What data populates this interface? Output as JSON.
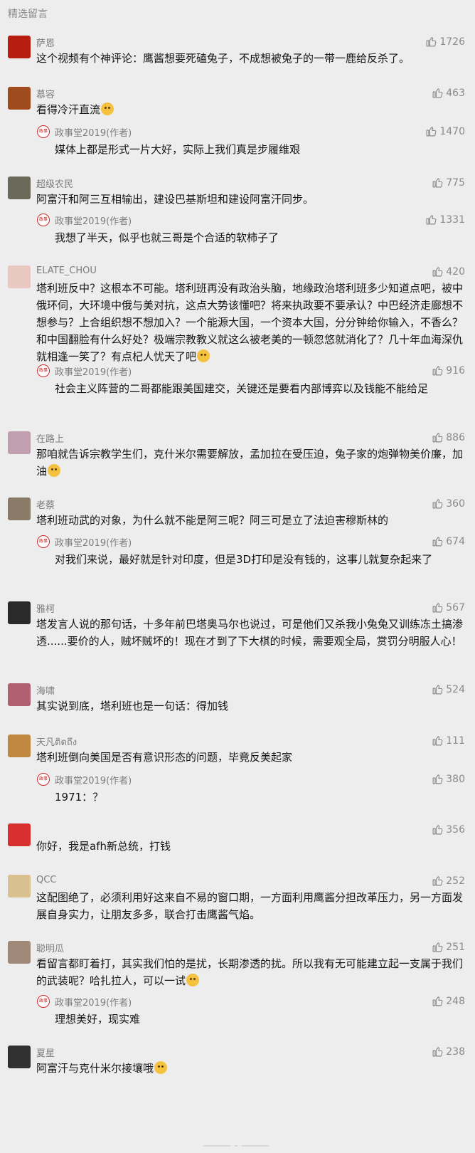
{
  "header": {
    "title": "精选留言"
  },
  "author_tag": "(作者)",
  "comments": [
    {
      "user": "萨恩",
      "likes": "1726",
      "text": "这个视频有个神评论：鹰酱想要死磕兔子，不成想被兔子的一带一鹿给反杀了。",
      "emoji": false,
      "avatar_color": "#b81d12"
    },
    {
      "user": "慕容",
      "likes": "463",
      "text": "看得冷汗直流",
      "emoji": true,
      "avatar_color": "#a04a20",
      "reply": {
        "name": "政事堂2019",
        "likes": "1470",
        "text": "媒体上都是形式一片大好，实际上我们真是步履维艰"
      }
    },
    {
      "user": "超级农民",
      "likes": "775",
      "text": "阿富汗和阿三互相输出，建设巴基斯坦和建设阿富汗同步。",
      "emoji": false,
      "avatar_color": "#6b6a5a",
      "reply": {
        "name": "政事堂2019",
        "likes": "1331",
        "text": "我想了半天，似乎也就三哥是个合适的软柿子了"
      }
    },
    {
      "user": "ELATE_CHOU",
      "likes": "420",
      "text": "塔利班反中？这根本不可能。塔利班再没有政治头脑，地缘政治塔利班多少知道点吧，被中俄环伺，大环境中俄与美对抗，这点大势该懂吧？将来执政要不要承认？中巴经济走廊想不想参与？上合组织想不想加入？一个能源大国，一个资本大国，分分钟给你输入，不香么？和中国翻脸有什么好处？极端宗教教义就这么被老美的一顿忽悠就消化了？几十年血海深仇就相逢一笑了？有点杞人忧天了吧",
      "emoji": true,
      "avatar_color": "#e8c8c0",
      "reply": {
        "name": "政事堂2019",
        "likes": "916",
        "text": "社会主义阵营的二哥都能跟美国建交，关键还是要看内部博弈以及钱能不能给足"
      }
    },
    {
      "user": "在路上",
      "likes": "886",
      "text": "那咱就告诉宗教学生们，克什米尔需要解放，孟加拉在受压迫，兔子家的炮弹物美价廉，加油",
      "emoji": true,
      "avatar_color": "#c0a0b0"
    },
    {
      "user": "老蔡",
      "likes": "360",
      "text": "塔利班动武的对象，为什么就不能是阿三呢？阿三可是立了法迫害穆斯林的",
      "emoji": false,
      "avatar_color": "#8a7a68",
      "reply": {
        "name": "政事堂2019",
        "likes": "674",
        "text": "对我们来说，最好就是针对印度，但是3D打印是没有钱的，这事儿就复杂起来了"
      }
    },
    {
      "user": "雅柯",
      "likes": "567",
      "text": "塔发言人说的那句话，十多年前巴塔奥马尔也说过，可是他们又杀我小兔兔又训练冻土搞渗透......要价的人，贼坏贼坏的！现在才到了下大棋的时候，需要观全局，赏罚分明服人心！",
      "emoji": false,
      "avatar_color": "#2a2a2a"
    },
    {
      "user": "海啸",
      "likes": "524",
      "text": "其实说到底，塔利班也是一句话：得加钱",
      "emoji": false,
      "avatar_color": "#b06070"
    },
    {
      "user": "天凡ติดถึง",
      "likes": "111",
      "text": "塔利班倒向美国是否有意识形态的问题，毕竟反美起家",
      "emoji": false,
      "avatar_color": "#c08840",
      "reply": {
        "name": "政事堂2019",
        "likes": "380",
        "text": "1971：？"
      }
    },
    {
      "user": "",
      "likes": "356",
      "text": "你好，我是afh新总统，打钱",
      "emoji": false,
      "avatar_color": "#d83030"
    },
    {
      "user": "QCC",
      "likes": "252",
      "text": "这配图绝了，必须利用好这来自不易的窗口期，一方面利用鹰酱分担改革压力，另一方面发展自身实力，让朋友多多，联合打击鹰酱气焰。",
      "emoji": false,
      "avatar_color": "#d8c090"
    },
    {
      "user": "聪明瓜",
      "likes": "251",
      "text": "看留言都盯着打，其实我们怕的是扰，长期渗透的扰。所以我有无可能建立起一支属于我们的武装呢？哈扎拉人，可以一试",
      "emoji": true,
      "avatar_color": "#a08878",
      "reply": {
        "name": "政事堂2019",
        "likes": "248",
        "text": "理想美好，现实难"
      }
    },
    {
      "user": "夏星",
      "likes": "238",
      "text": "阿富汗与克什米尔接壤哦",
      "emoji": true,
      "avatar_color": "#303030"
    }
  ]
}
